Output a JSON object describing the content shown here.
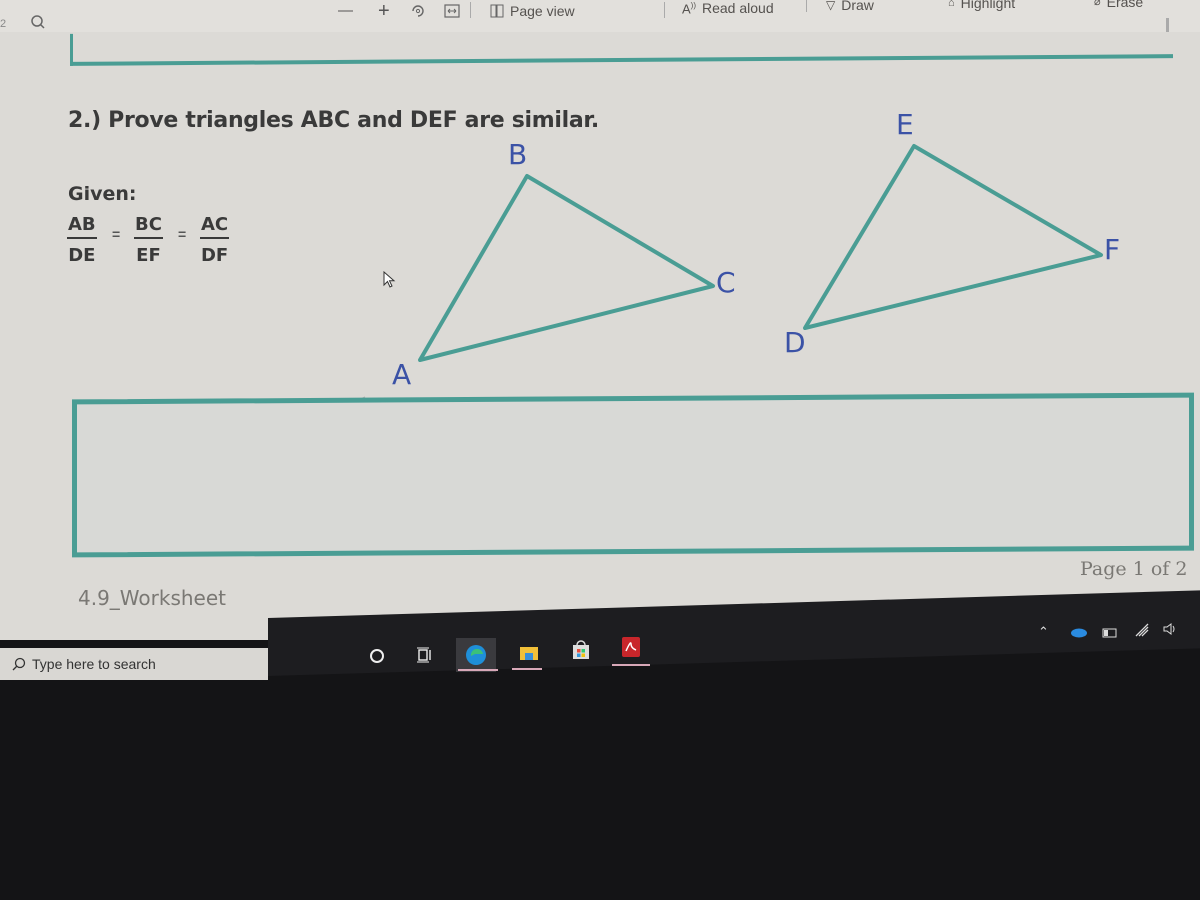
{
  "toolbar": {
    "page_number": "2",
    "search_icon": "search-icon",
    "zoom_out": "—",
    "zoom_in": "+",
    "rotate_icon": "rotate-icon",
    "fit_icon": "fit-width-icon",
    "page_view_label": "Page view",
    "read_aloud_label": "Read aloud",
    "draw_label": "Draw",
    "highlight_label": "Highlight",
    "erase_label": "Erase"
  },
  "document": {
    "question": "2.) Prove triangles ABC and DEF are similar.",
    "given_label": "Given:",
    "ratios": [
      {
        "num": "AB",
        "den": "DE"
      },
      {
        "num": "BC",
        "den": "EF"
      },
      {
        "num": "AC",
        "den": "DF"
      }
    ],
    "equals_sign": "=",
    "triangle_abc": {
      "labels": [
        "A",
        "B",
        "C"
      ]
    },
    "triangle_def": {
      "labels": [
        "D",
        "E",
        "F"
      ]
    },
    "footer_left": "4.9_Worksheet",
    "footer_right": "Page 1 of 2",
    "accent_color": "#4a9d94",
    "label_color": "#3b52a6"
  },
  "taskbar": {
    "search_placeholder": "Type here to search",
    "apps": [
      "cortana",
      "task-view",
      "edge",
      "file-explorer",
      "store",
      "acrobat"
    ]
  }
}
